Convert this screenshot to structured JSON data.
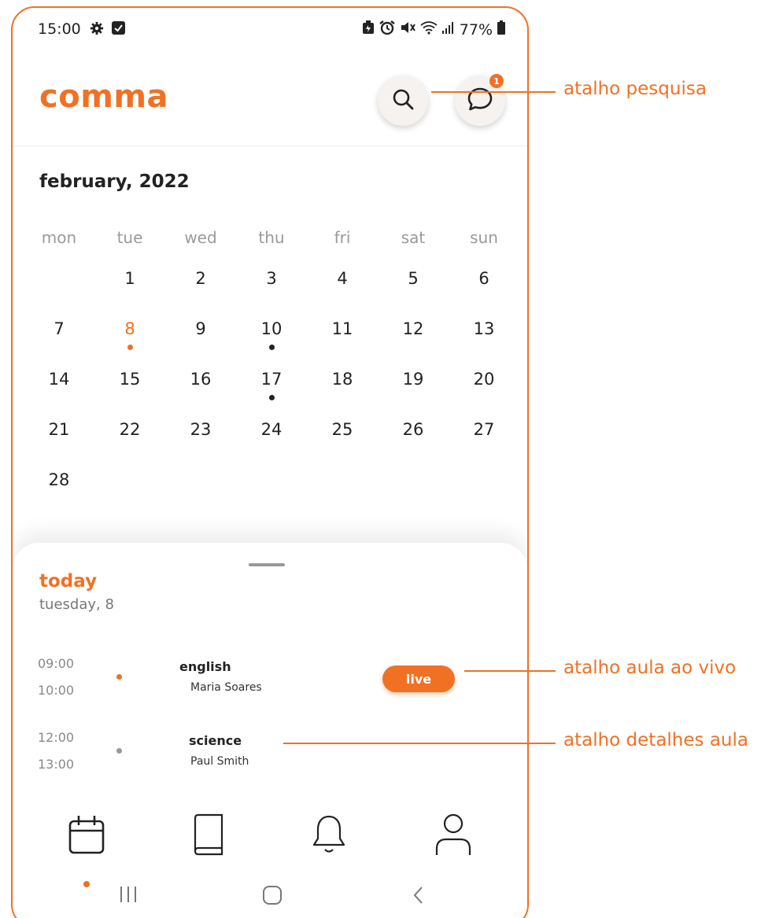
{
  "colors": {
    "accent": "#F07124",
    "text": "#222222",
    "muted": "#9a9a9a"
  },
  "status_bar": {
    "time": "15:00",
    "battery": "77%",
    "left_icons": [
      "gear-icon",
      "checkbox-icon"
    ],
    "right_icons": [
      "battery-saver-icon",
      "alarm-icon",
      "mute-icon",
      "wifi-icon",
      "signal-icon",
      "battery-icon"
    ]
  },
  "header": {
    "brand": "comma",
    "chat_badge": "1"
  },
  "calendar": {
    "month_title": "february, 2022",
    "weekdays": [
      "mon",
      "tue",
      "wed",
      "thu",
      "fri",
      "sat",
      "sun"
    ],
    "weeks": [
      [
        "",
        "1",
        "2",
        "3",
        "4",
        "5",
        "6"
      ],
      [
        "7",
        "8",
        "9",
        "10",
        "11",
        "12",
        "13"
      ],
      [
        "14",
        "15",
        "16",
        "17",
        "18",
        "19",
        "20"
      ],
      [
        "21",
        "22",
        "23",
        "24",
        "25",
        "26",
        "27"
      ],
      [
        "28",
        "",
        "",
        "",
        "",
        "",
        ""
      ]
    ],
    "selected_day": "8",
    "days_with_events": [
      "8",
      "10",
      "17"
    ]
  },
  "today": {
    "label": "today",
    "date": "tuesday, 8",
    "lessons": [
      {
        "start": "09:00",
        "end": "10:00",
        "subject": "english",
        "teacher": "Maria Soares",
        "live_label": "live",
        "dot_color": "#F07124"
      },
      {
        "start": "12:00",
        "end": "13:00",
        "subject": "science",
        "teacher": "Paul Smith",
        "dot_color": "#999999"
      }
    ]
  },
  "bottom_nav": {
    "items": [
      "calendar-icon",
      "book-icon",
      "bell-icon",
      "profile-icon"
    ],
    "active": "calendar-icon"
  },
  "annotations": {
    "search": "atalho pesquisa",
    "live": "atalho aula ao vivo",
    "details": "atalho detalhes aula"
  }
}
